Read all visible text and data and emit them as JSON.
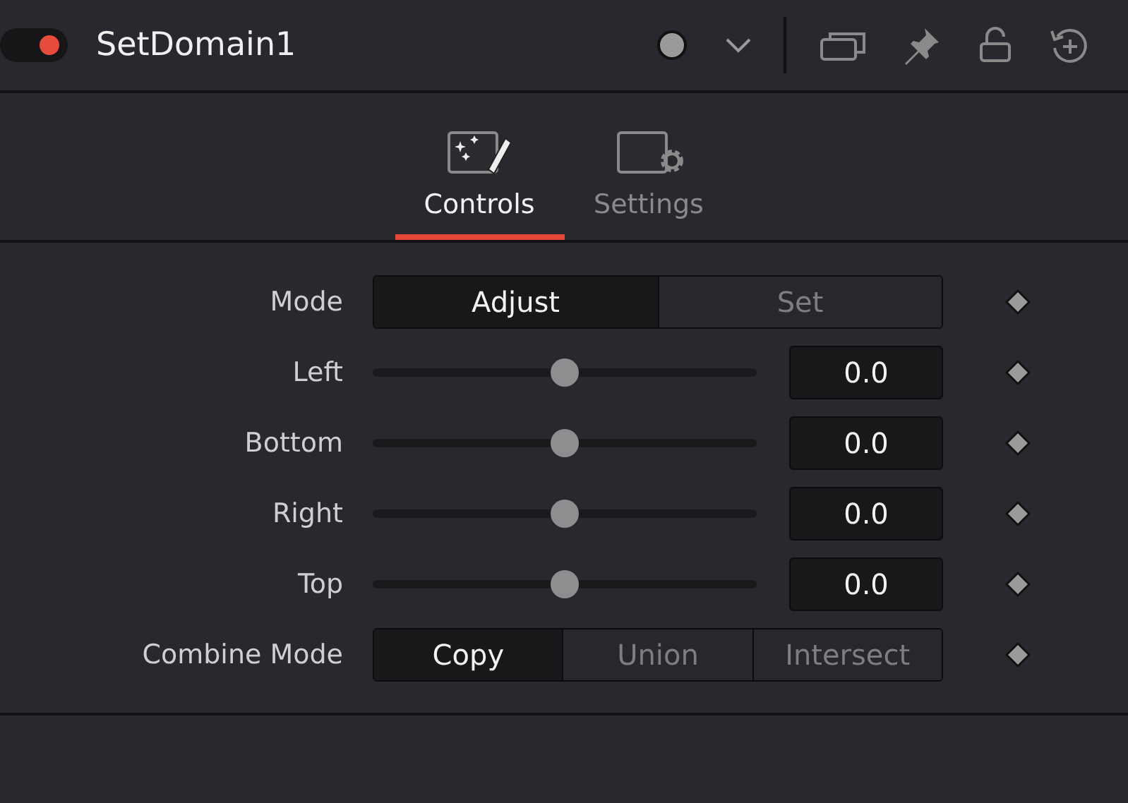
{
  "node": {
    "title": "SetDomain1",
    "enabled": true
  },
  "tabs": [
    {
      "label": "Controls",
      "selected": true,
      "kind": "controls"
    },
    {
      "label": "Settings",
      "selected": false,
      "kind": "settings"
    }
  ],
  "controls": [
    {
      "kind": "choice",
      "label": "Mode",
      "options": [
        {
          "label": "Adjust",
          "selected": true
        },
        {
          "label": "Set",
          "selected": false
        }
      ]
    },
    {
      "kind": "slider",
      "label": "Left",
      "level": 0.5,
      "value": "0.0"
    },
    {
      "kind": "slider",
      "label": "Bottom",
      "level": 0.5,
      "value": "0.0"
    },
    {
      "kind": "slider",
      "label": "Right",
      "level": 0.5,
      "value": "0.0"
    },
    {
      "kind": "slider",
      "label": "Top",
      "level": 0.5,
      "value": "0.0"
    },
    {
      "kind": "choice",
      "label": "Combine Mode",
      "options": [
        {
          "label": "Copy",
          "selected": true
        },
        {
          "label": "Union",
          "selected": false
        },
        {
          "label": "Intersect",
          "selected": false
        }
      ]
    }
  ]
}
